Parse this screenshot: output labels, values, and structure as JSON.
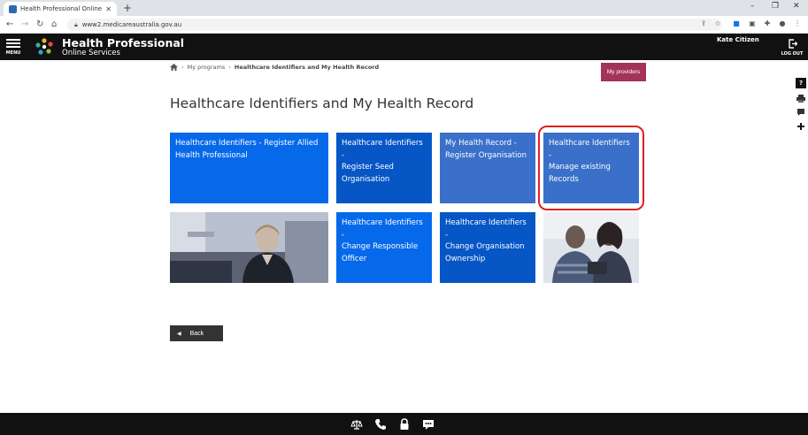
{
  "browser": {
    "tab_title": "Health Professional Online Servic",
    "tab_close": "✕",
    "new_tab": "+",
    "url": "www2.medicareaustralia.gov.au",
    "controls": {
      "minimize": "–",
      "restore": "❐",
      "close": "✕"
    }
  },
  "header": {
    "menu_label": "MENU",
    "logo_title": "Health Professional",
    "logo_subtitle": "Online Services",
    "user_name": "Kate Citizen",
    "logout_label": "LOG OUT"
  },
  "side_tools": {
    "help": "?"
  },
  "breadcrumb": {
    "items": [
      "My programs"
    ],
    "current": "Healthcare Identifiers and My Health Record"
  },
  "actions": {
    "my_providers": "My providers",
    "back": "Back"
  },
  "page": {
    "title": "Healthcare Identifiers and My Health Record"
  },
  "tiles": [
    {
      "lines": [
        "Healthcare Identifiers - Register Allied",
        "Health Professional"
      ],
      "color": "#0669ea"
    },
    {
      "lines": [
        "Healthcare Identifiers -",
        "Register Seed",
        "Organisation"
      ],
      "color": "#0656c6"
    },
    {
      "lines": [
        "My Health Record -",
        "Register Organisation"
      ],
      "color": "#3a70c9"
    },
    {
      "lines": [
        "Healthcare Identifiers -",
        "Manage existing",
        "Records"
      ],
      "color": "#3a70c9",
      "highlighted": true
    },
    {
      "lines": [
        "Healthcare Identifiers -",
        "Change Responsible",
        "Officer"
      ],
      "color": "#0669ea"
    },
    {
      "lines": [
        "Healthcare Identifiers -",
        "Change Organisation",
        "Ownership"
      ],
      "color": "#0656c6"
    }
  ],
  "colors": {
    "header_bg": "#111111",
    "accent_magenta": "#a3335a",
    "highlight_red": "#e02020",
    "back_button": "#333333"
  },
  "footer_icons": [
    "scales-icon",
    "phone-icon",
    "lock-icon",
    "chat-icon"
  ]
}
